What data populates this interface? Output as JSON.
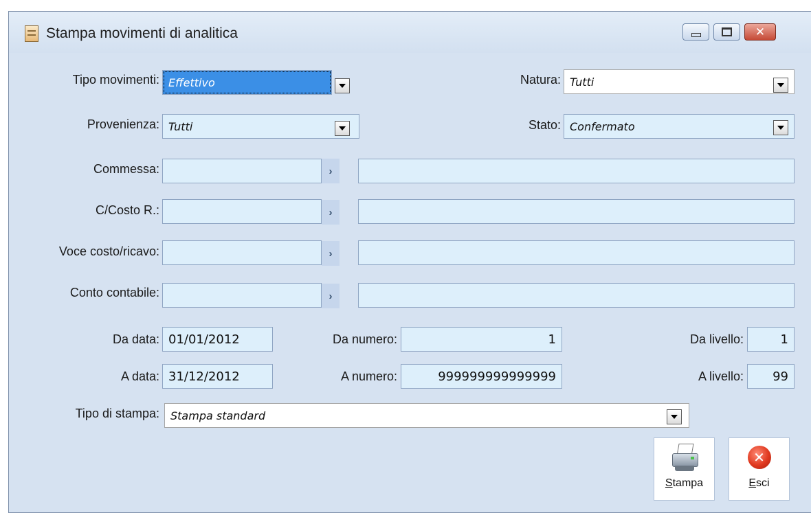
{
  "window": {
    "title": "Stampa movimenti di analitica",
    "close_glyph": "✕"
  },
  "icons": {
    "app": "document-icon",
    "dropdown": "chevron-down-icon",
    "zoom": "chevron-right-icon",
    "print": "printer-icon",
    "exit": "close-circle-icon"
  },
  "colors": {
    "field_bg": "#ddeffb",
    "selected_bg": "#3b8fe6",
    "window_bg": "#d6e2f1"
  },
  "form": {
    "tipo_movimenti": {
      "label": "Tipo movimenti:",
      "value": "Effettivo"
    },
    "natura": {
      "label": "Natura:",
      "value": "Tutti"
    },
    "provenienza": {
      "label": "Provenienza:",
      "value": "Tutti"
    },
    "stato": {
      "label": "Stato:",
      "value": "Confermato"
    },
    "commessa": {
      "label": "Commessa:",
      "code": "",
      "description": ""
    },
    "centro_costo": {
      "label": "C/Costo R.:",
      "code": "",
      "description": ""
    },
    "voce_costo": {
      "label": "Voce costo/ricavo:",
      "code": "",
      "description": ""
    },
    "conto_contabile": {
      "label": "Conto contabile:",
      "code": "",
      "description": ""
    },
    "zoom_glyph": "›",
    "da_data": {
      "label": "Da data:",
      "value": "01/01/2012"
    },
    "a_data": {
      "label": "A data:",
      "value": "31/12/2012"
    },
    "da_numero": {
      "label": "Da numero:",
      "value": "1"
    },
    "a_numero": {
      "label": "A numero:",
      "value": "999999999999999"
    },
    "da_livello": {
      "label": "Da livello:",
      "value": "1"
    },
    "a_livello": {
      "label": "A livello:",
      "value": "99"
    },
    "tipo_stampa": {
      "label": "Tipo di stampa:",
      "value": "Stampa standard"
    }
  },
  "buttons": {
    "stampa": {
      "mnemonic": "S",
      "rest": "tampa"
    },
    "esci": {
      "mnemonic": "E",
      "rest": "sci",
      "glyph": "✕"
    }
  }
}
